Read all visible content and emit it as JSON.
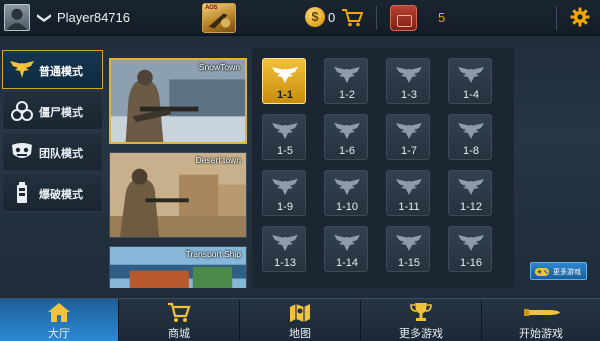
{
  "topbar": {
    "player_name": "Player84716",
    "game_logo_text": "AOS",
    "coin_symbol": "$",
    "coin_count": "0",
    "backpack_count": "5",
    "icons": [
      "avatar",
      "rank-chevron-icon",
      "game-logo",
      "coin-icon",
      "cart-icon",
      "backpack-icon",
      "gear-icon"
    ]
  },
  "modes": [
    {
      "label": "普通模式",
      "icon": "eagle-icon",
      "active": true
    },
    {
      "label": "僵尸模式",
      "icon": "biohazard-icon",
      "active": false
    },
    {
      "label": "团队模式",
      "icon": "team-icon",
      "active": false
    },
    {
      "label": "爆破模式",
      "icon": "bomb-icon",
      "active": false
    }
  ],
  "maps": [
    {
      "title": "SnowTown",
      "selected": true
    },
    {
      "title": "Desert town",
      "selected": false
    },
    {
      "title": "Transport Ship",
      "selected": false
    }
  ],
  "levels": [
    "1-1",
    "1-2",
    "1-3",
    "1-4",
    "1-5",
    "1-6",
    "1-7",
    "1-8",
    "1-9",
    "1-10",
    "1-11",
    "1-12",
    "1-13",
    "1-14",
    "1-15",
    "1-16"
  ],
  "active_level": "1-1",
  "more_games_side": "更多游戏",
  "bottomnav": [
    {
      "label": "大厅",
      "icon": "home-icon",
      "active": true
    },
    {
      "label": "商城",
      "icon": "cart-icon",
      "active": false
    },
    {
      "label": "地图",
      "icon": "map-icon",
      "active": false
    },
    {
      "label": "更多游戏",
      "icon": "trophy-icon",
      "active": false
    },
    {
      "label": "开始游戏",
      "icon": "bullet-icon",
      "active": false
    }
  ],
  "colors": {
    "accent_gold": "#e6b42a",
    "active_blue": "#2d8ad6",
    "count_orange": "#f0a800"
  }
}
